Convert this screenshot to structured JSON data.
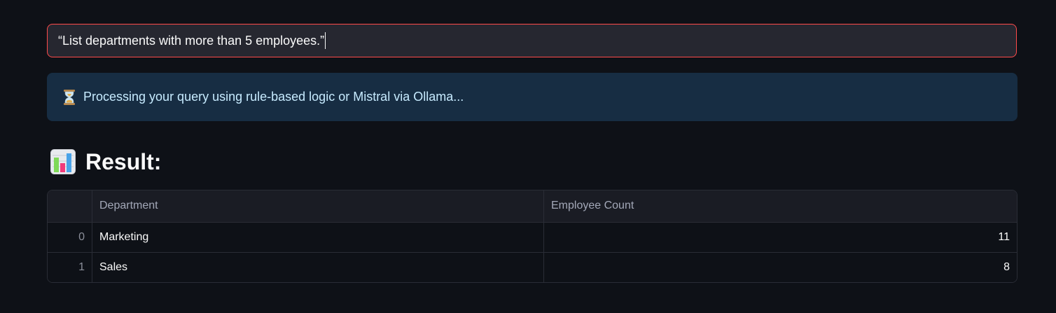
{
  "query": {
    "value": "“List departments with more than 5 employees.”"
  },
  "info": {
    "icon": "hourglass-icon",
    "message": "Processing your query using rule-based logic or Mistral via Ollama..."
  },
  "result": {
    "icon": "bar-chart-icon",
    "title": "Result:"
  },
  "table": {
    "columns": [
      "",
      "Department",
      "Employee Count"
    ],
    "rows": [
      {
        "index": "0",
        "department": "Marketing",
        "count": "11"
      },
      {
        "index": "1",
        "department": "Sales",
        "count": "8"
      }
    ]
  },
  "colors": {
    "background": "#0e1117",
    "input_border": "#ff4b4b",
    "info_bg": "#172d43",
    "info_text": "#c7ebff"
  }
}
